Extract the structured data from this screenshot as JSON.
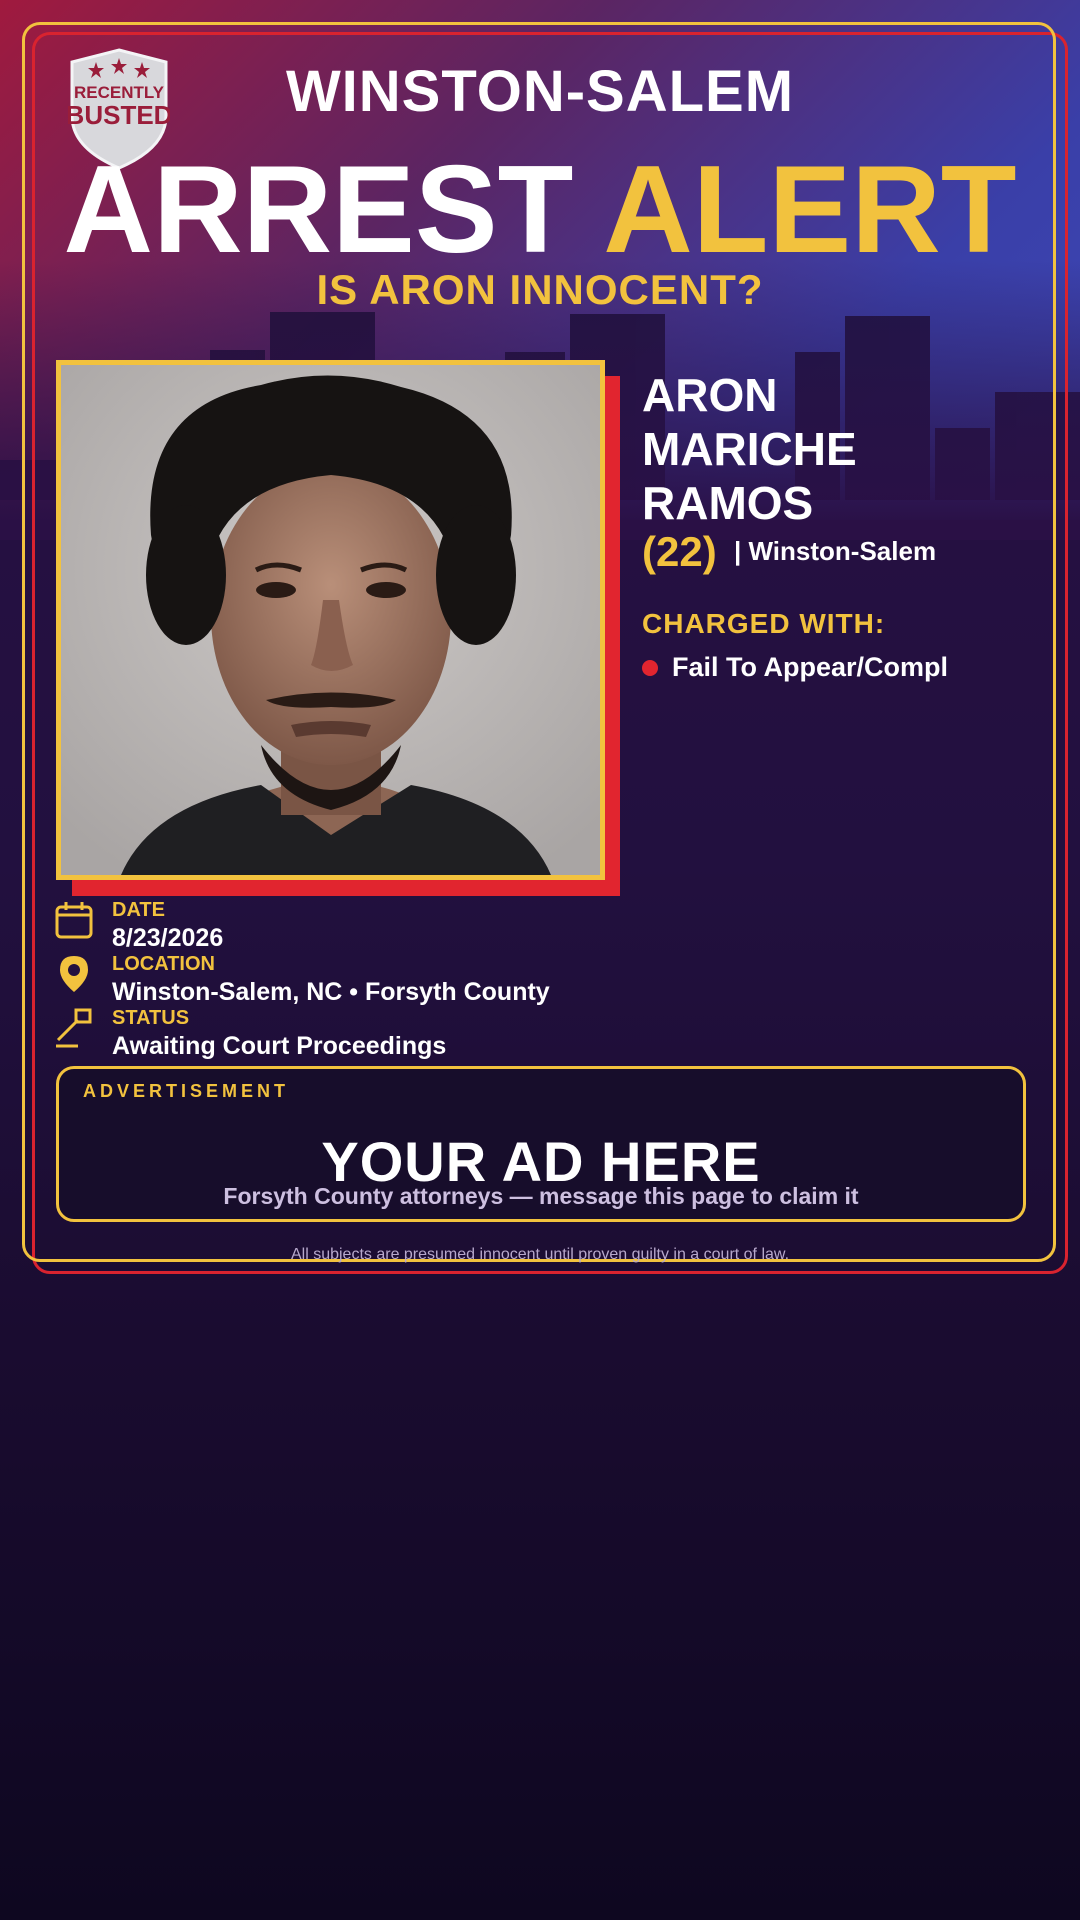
{
  "badge": {
    "line1": "RECENTLY",
    "line2": "BUSTED"
  },
  "header": {
    "city": "WINSTON-SALEM",
    "headline_white": "ARREST",
    "headline_yellow": "ALERT",
    "question": "IS ARON INNOCENT?"
  },
  "subject": {
    "name_lines": [
      "ARON",
      "MARICHE",
      "RAMOS"
    ],
    "age": "(22)",
    "city": "| Winston-Salem",
    "charged_label": "CHARGED WITH:",
    "charges": [
      "Fail To Appear/Compl"
    ]
  },
  "details": {
    "date_label": "DATE",
    "date_value": "8/23/2026",
    "location_label": "LOCATION",
    "location_value": "Winston-Salem, NC • Forsyth County",
    "status_label": "STATUS",
    "status_value": "Awaiting Court Proceedings"
  },
  "ad": {
    "label": "ADVERTISEMENT",
    "title": "YOUR AD HERE",
    "subtitle": "Forsyth County attorneys — message this page to claim it"
  },
  "disclaimer": "All subjects are presumed innocent until proven guilty in a court of law.",
  "colors": {
    "accent_yellow": "#f2c23e",
    "accent_red": "#e1252f",
    "header_red": "#a01a3e",
    "header_blue": "#3d48b8"
  }
}
